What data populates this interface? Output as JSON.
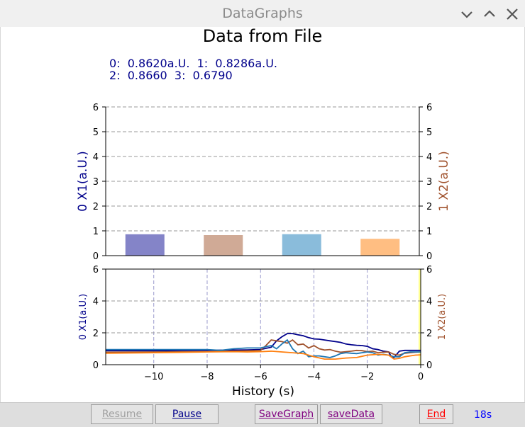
{
  "window": {
    "title": "DataGraphs"
  },
  "figure": {
    "title": "Data from File",
    "readout_line1": "0:  0.8620a.U.  1:  0.8286a.U.",
    "readout_line2": "2:  0.8660  3:  0.6790"
  },
  "chart_data": [
    {
      "type": "bar",
      "categories": [
        "0",
        "1",
        "2",
        "3"
      ],
      "values": [
        0.862,
        0.8286,
        0.866,
        0.679
      ],
      "bar_colors": [
        "#8484c8",
        "#d0aa96",
        "#8abcdb",
        "#ffbe82"
      ],
      "ylabel": "0 X1(a.U.)",
      "ylabel_color": "#00008b",
      "y2label": "1 X2(a.U.)",
      "y2label_color": "#a0522d",
      "ylim": [
        0,
        6
      ],
      "yticks": [
        "0",
        "1",
        "2",
        "3",
        "4",
        "5",
        "6"
      ],
      "grid": "horizontal dashed"
    },
    {
      "type": "line",
      "xlabel": "History (s)",
      "ylabel": "0 X1(a.U.)",
      "ylabel_color": "#00008b",
      "y2label": "1 X2(a.U.)",
      "y2label_color": "#a0522d",
      "xlim": [
        -11.8,
        0
      ],
      "ylim": [
        0,
        6
      ],
      "xticks": [
        "−10",
        "−8",
        "−6",
        "−4",
        "−2",
        "0"
      ],
      "yticks": [
        "0",
        "2",
        "4",
        "6"
      ],
      "grid": "dashed",
      "series": [
        {
          "color": "#00008b",
          "x": [
            -11.8,
            -10,
            -8,
            -7,
            -6.5,
            -6,
            -5.6,
            -5.4,
            -5.2,
            -5,
            -4.8,
            -4.6,
            -4.4,
            -4.2,
            -4,
            -3.8,
            -3.6,
            -3.4,
            -3.2,
            -3,
            -2.8,
            -2.6,
            -2.4,
            -2.2,
            -2,
            -1.8,
            -1.6,
            -1.4,
            -1.2,
            -1.1,
            -1.0,
            -0.8,
            -0.6,
            -0.4,
            -0.2,
            0
          ],
          "y": [
            0.88,
            0.88,
            0.9,
            0.92,
            0.93,
            0.95,
            1.1,
            1.5,
            1.75,
            1.95,
            1.95,
            1.88,
            1.82,
            1.7,
            1.62,
            1.6,
            1.55,
            1.5,
            1.45,
            1.4,
            1.3,
            1.25,
            1.22,
            1.2,
            1.15,
            1.0,
            0.95,
            0.85,
            0.8,
            0.5,
            0.45,
            0.85,
            0.9,
            0.9,
            0.9,
            0.9
          ]
        },
        {
          "color": "#a0522d",
          "x": [
            -11.8,
            -10,
            -8,
            -7,
            -6.5,
            -6,
            -5.8,
            -5.6,
            -5.4,
            -5.2,
            -5,
            -4.8,
            -4.6,
            -4.4,
            -4.2,
            -4,
            -3.8,
            -3.6,
            -3.4,
            -3.2,
            -3,
            -2.8,
            -2.6,
            -2.4,
            -2.2,
            -2,
            -1.8,
            -1.6,
            -1.4,
            -1.2,
            -1.0,
            -0.8,
            -0.6,
            -0.4,
            -0.2,
            0
          ],
          "y": [
            0.78,
            0.8,
            0.82,
            0.85,
            0.87,
            0.9,
            1.2,
            1.55,
            1.5,
            1.45,
            1.35,
            1.55,
            1.25,
            1.3,
            1.05,
            1.2,
            1.0,
            0.92,
            0.95,
            0.85,
            0.78,
            0.82,
            0.85,
            0.9,
            0.88,
            0.82,
            0.85,
            0.75,
            0.78,
            0.8,
            0.65,
            0.6,
            0.72,
            0.75,
            0.78,
            0.8
          ]
        },
        {
          "color": "#1f77b4",
          "x": [
            -11.8,
            -10,
            -8,
            -7.5,
            -7,
            -6.5,
            -6,
            -5.6,
            -5.4,
            -5.2,
            -5,
            -4.8,
            -4.6,
            -4.4,
            -4.2,
            -4,
            -3.8,
            -3.6,
            -3.4,
            -3.2,
            -3,
            -2.8,
            -2.6,
            -2.4,
            -2.2,
            -2,
            -1.8,
            -1.6,
            -1.4,
            -1.2,
            -1.0,
            -0.8,
            -0.6,
            -0.4,
            -0.2,
            0
          ],
          "y": [
            0.95,
            0.95,
            0.95,
            0.9,
            1.0,
            1.05,
            1.05,
            1.2,
            1.0,
            1.3,
            1.55,
            1.0,
            0.7,
            0.85,
            0.5,
            0.55,
            0.55,
            0.5,
            0.45,
            0.55,
            0.7,
            0.75,
            0.72,
            0.7,
            0.75,
            0.8,
            0.75,
            0.6,
            0.65,
            0.6,
            0.5,
            0.5,
            0.75,
            0.8,
            0.8,
            0.8
          ]
        },
        {
          "color": "#ff7f0e",
          "x": [
            -11.8,
            -10,
            -8,
            -7,
            -6.5,
            -6,
            -5.6,
            -5.2,
            -4.8,
            -4.4,
            -4,
            -3.6,
            -3.2,
            -2.8,
            -2.4,
            -2,
            -1.6,
            -1.2,
            -1.0,
            -0.8,
            -0.6,
            -0.4,
            -0.2,
            0
          ],
          "y": [
            0.72,
            0.75,
            0.8,
            0.82,
            0.8,
            0.82,
            0.85,
            0.8,
            0.75,
            0.7,
            0.5,
            0.35,
            0.35,
            0.42,
            0.45,
            0.6,
            0.65,
            0.6,
            0.35,
            0.4,
            0.5,
            0.55,
            0.6,
            0.62
          ]
        }
      ]
    }
  ],
  "buttons": {
    "resume": "Resume",
    "pause": "Pause",
    "save_graph": "SaveGraph",
    "save_data": "saveData",
    "end": "End"
  },
  "status": {
    "elapsed": "18s"
  }
}
